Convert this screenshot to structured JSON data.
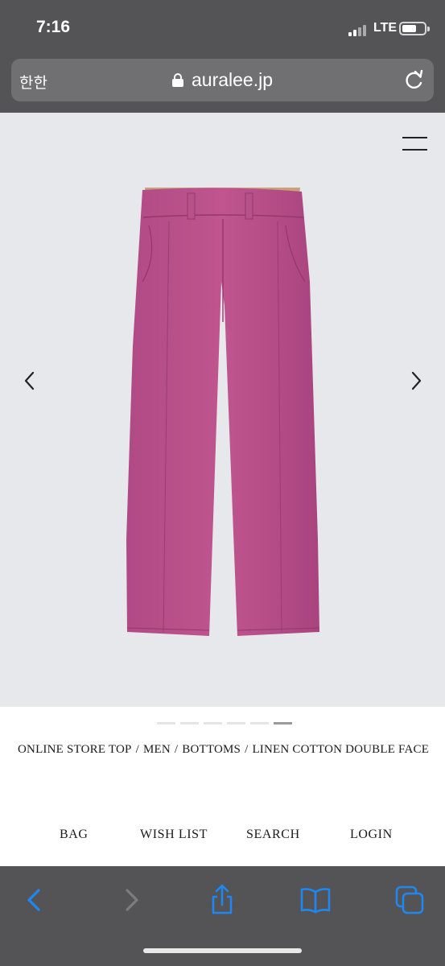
{
  "status_bar": {
    "time": "7:16",
    "network": "LTE"
  },
  "url_bar": {
    "left_text": "한한",
    "url": "auralee.jp",
    "icons": [
      "lock-icon",
      "reload-icon"
    ]
  },
  "header": {
    "icons": [
      "menu-icon"
    ]
  },
  "carousel": {
    "image_subject": "pink linen trousers",
    "icons": [
      "chevron-left-icon",
      "chevron-right-icon"
    ],
    "dot_count": 6,
    "active_index": 5
  },
  "breadcrumb": {
    "items": [
      "ONLINE STORE TOP",
      "MEN",
      "BOTTOMS",
      "LINEN COTTON DOUBLE FACE"
    ],
    "separator": "/"
  },
  "footer_nav": {
    "bag": "BAG",
    "wish_list": "WISH LIST",
    "search": "SEARCH",
    "login": "LOGIN"
  },
  "toolbar": {
    "icons": [
      "back-icon",
      "forward-icon",
      "share-icon",
      "bookmarks-icon",
      "tabs-icon"
    ],
    "accent_color": "#1e87f0"
  }
}
